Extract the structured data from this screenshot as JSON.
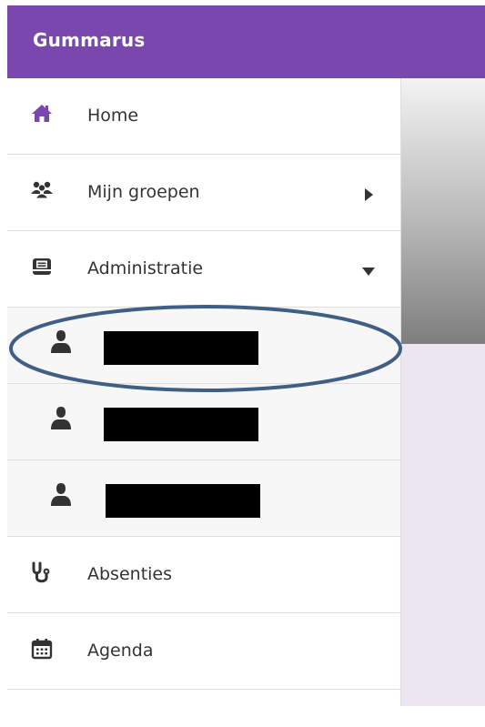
{
  "app": {
    "title": "Gummarus",
    "accent_color": "#7a47ae",
    "icon_color_primary": "#7a47ae",
    "icon_color_dark": "#333333",
    "annotation_color": "#3f5f87"
  },
  "sidebar": {
    "items": [
      {
        "label": "Home",
        "icon": "home-icon"
      },
      {
        "label": "Mijn groepen",
        "icon": "groups-icon",
        "chevron": "chevron-right-icon"
      },
      {
        "label": "Administratie",
        "icon": "inbox-icon",
        "chevron": "chevron-down-icon"
      },
      {
        "label": "",
        "icon": "user-icon",
        "redacted": true
      },
      {
        "label": "",
        "icon": "user-icon",
        "redacted": true
      },
      {
        "label": "",
        "icon": "user-icon",
        "redacted": true
      },
      {
        "label": "Absenties",
        "icon": "stethoscope-icon"
      },
      {
        "label": "Agenda",
        "icon": "calendar-icon"
      }
    ]
  }
}
